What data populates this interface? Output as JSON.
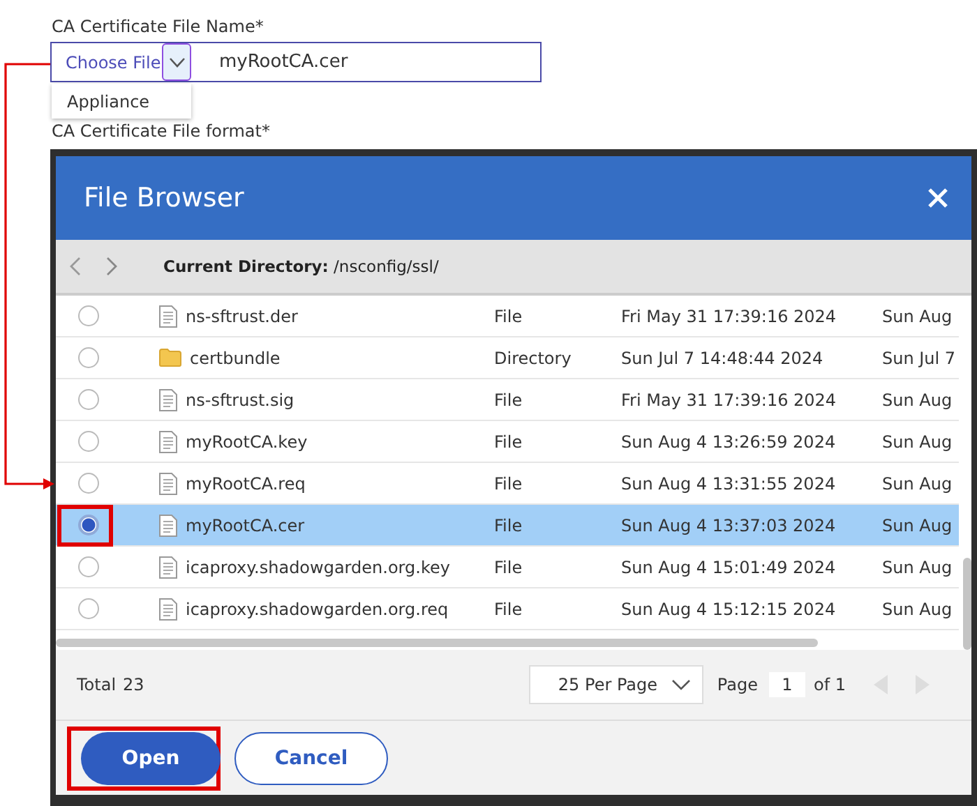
{
  "form": {
    "file_name_label": "CA Certificate File Name*",
    "choose_file": "Choose File",
    "file_name": "myRootCA.cer",
    "menu_items": [
      "Appliance"
    ],
    "format_label": "CA Certificate File format*"
  },
  "dialog": {
    "title": "File Browser",
    "directory_label": "Current Directory:",
    "directory": "/nsconfig/ssl/",
    "rows": [
      {
        "name": "ns-sftrust.der",
        "kind": "file",
        "type": "File",
        "column_4": "Fri May 31 17:39:16 2024",
        "column_5": "Sun Aug",
        "selected": false
      },
      {
        "name": "certbundle",
        "kind": "directory",
        "type": "Directory",
        "column_4": "Sun Jul  7 14:48:44 2024",
        "column_5": "Sun Jul  7",
        "selected": false
      },
      {
        "name": "ns-sftrust.sig",
        "kind": "file",
        "type": "File",
        "column_4": "Fri May 31 17:39:16 2024",
        "column_5": "Sun Aug",
        "selected": false
      },
      {
        "name": "myRootCA.key",
        "kind": "file",
        "type": "File",
        "column_4": "Sun Aug  4 13:26:59 2024",
        "column_5": "Sun Aug",
        "selected": false
      },
      {
        "name": "myRootCA.req",
        "kind": "file",
        "type": "File",
        "column_4": "Sun Aug  4 13:31:55 2024",
        "column_5": "Sun Aug",
        "selected": false
      },
      {
        "name": "myRootCA.cer",
        "kind": "file",
        "type": "File",
        "column_4": "Sun Aug  4 13:37:03 2024",
        "column_5": "Sun Aug",
        "selected": true
      },
      {
        "name": "icaproxy.shadowgarden.org.key",
        "kind": "file",
        "type": "File",
        "column_4": "Sun Aug  4 15:01:49 2024",
        "column_5": "Sun Aug",
        "selected": false
      },
      {
        "name": "icaproxy.shadowgarden.org.req",
        "kind": "file",
        "type": "File",
        "column_4": "Sun Aug  4 15:12:15 2024",
        "column_5": "Sun Aug",
        "selected": false
      }
    ],
    "total_label": "Total",
    "total": "23",
    "per_page": "25 Per Page",
    "page_label": "Page",
    "page": "1",
    "page_of": "of 1",
    "buttons": [
      {
        "label": "Open",
        "kind": "primary"
      },
      {
        "label": "Cancel",
        "kind": "secondary"
      }
    ]
  }
}
